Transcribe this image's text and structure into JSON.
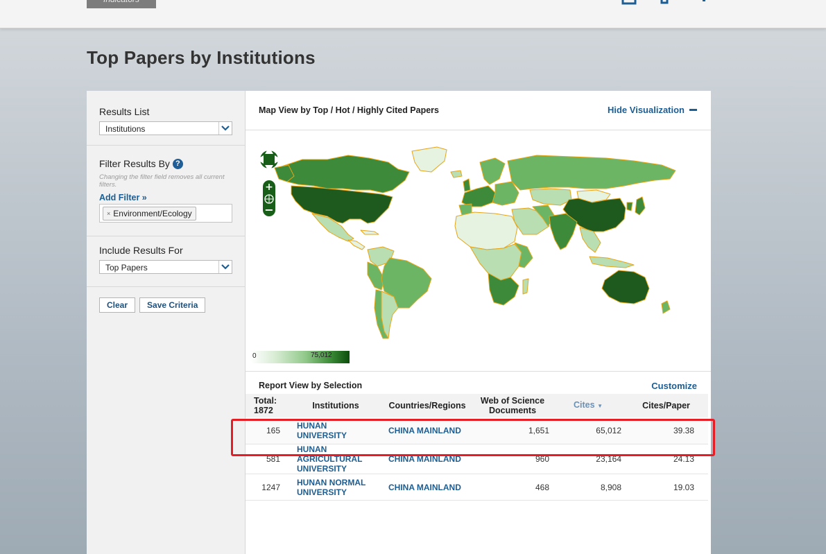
{
  "header": {
    "brand_tab_label": "Indicators",
    "icons": [
      "export-icon",
      "share-icon",
      "add-icon"
    ]
  },
  "page": {
    "title": "Top Papers by Institutions"
  },
  "left_panel": {
    "results_list": {
      "label": "Results List",
      "value": "Institutions"
    },
    "filter": {
      "label": "Filter Results By",
      "help_icon": "?",
      "hint": "Changing the filter field removes all current filters.",
      "add_filter_label": "Add Filter »",
      "chips": [
        {
          "remove": "×",
          "label": "Environment/Ecology"
        }
      ]
    },
    "include": {
      "label": "Include Results For",
      "value": "Top Papers"
    },
    "buttons": {
      "clear": "Clear",
      "save": "Save Criteria"
    }
  },
  "map_view": {
    "title": "Map View by Top / Hot / Highly Cited Papers",
    "hide_label": "Hide Visualization",
    "legend": {
      "min": "0",
      "max": "75,012"
    },
    "colors": {
      "darkest": "#1e5a1e",
      "dark": "#3d8a3a",
      "mid": "#6cb565",
      "light": "#b9deb2",
      "lightest": "#e6f3e1",
      "border": "#e6a517",
      "ocean": "#ffffff"
    }
  },
  "report_view": {
    "title": "Report View by Selection",
    "customize_label": "Customize",
    "columns": {
      "total_label": "Total:",
      "total_value": "1872",
      "institutions": "Institutions",
      "countries": "Countries/Regions",
      "wos_docs": "Web of Science Documents",
      "cites": "Cites",
      "cites_per_paper": "Cites/Paper"
    },
    "rows": [
      {
        "rank": "165",
        "institution": "HUNAN UNIVERSITY",
        "country": "CHINA MAINLAND",
        "docs": "1,651",
        "cites": "65,012",
        "cpp": "39.38"
      },
      {
        "rank": "581",
        "institution": "HUNAN AGRICULTURAL UNIVERSITY",
        "country": "CHINA MAINLAND",
        "docs": "960",
        "cites": "23,164",
        "cpp": "24.13"
      },
      {
        "rank": "1247",
        "institution": "HUNAN NORMAL UNIVERSITY",
        "country": "CHINA MAINLAND",
        "docs": "468",
        "cites": "8,908",
        "cpp": "19.03"
      }
    ]
  },
  "highlight": {
    "color": "#e61d25"
  }
}
